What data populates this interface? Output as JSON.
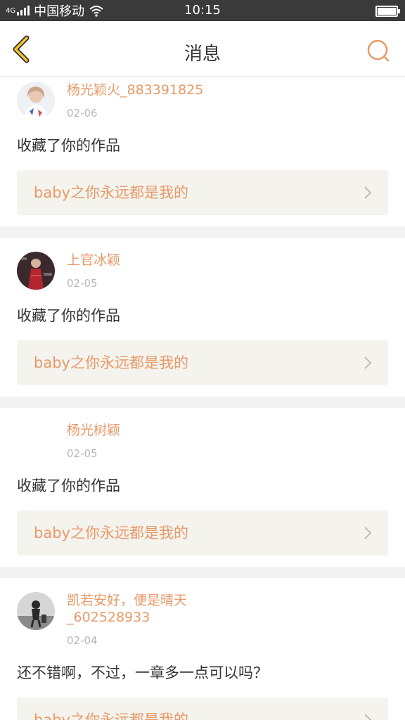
{
  "status_bar": {
    "carrier": "中国移动",
    "network": "4G",
    "time": "10:15"
  },
  "nav": {
    "title": "消息"
  },
  "colors": {
    "accent": "#e89a68",
    "link_bg": "#f4f3ee",
    "date": "#b8b8b8",
    "text": "#333333"
  },
  "messages": [
    {
      "user": "杨光颖火_883391825",
      "date": "02-06",
      "action": "收藏了你的作品",
      "work": "baby之你永远都是我的",
      "avatar": "girl-photo"
    },
    {
      "user": "上官冰颖",
      "date": "02-05",
      "action": "收藏了你的作品",
      "work": "baby之你永远都是我的",
      "avatar": "red-dress-photo"
    },
    {
      "user": "杨光树颖",
      "date": "02-05",
      "action": "收藏了你的作品",
      "work": "baby之你永远都是我的",
      "avatar": "none"
    },
    {
      "user": "凯若安好，便是晴天_602528933",
      "date": "02-04",
      "action": "还不错啊，不过，一章多一点可以吗？",
      "work": "baby之你永远都是我的",
      "avatar": "grayscale-photo"
    }
  ]
}
